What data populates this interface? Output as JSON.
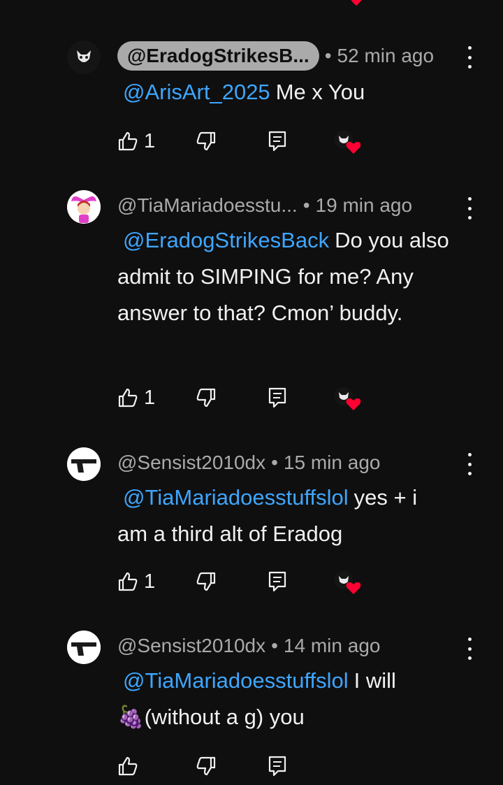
{
  "comments": [
    {
      "handle": "@EradogStrikesB...",
      "handle_style": "highlighted",
      "time": "52 min ago",
      "mention": "@ArisArt_2025",
      "text": "Me x You",
      "likes": "1",
      "creator_heart": true,
      "avatar": "white-dog-icon"
    },
    {
      "handle": "@TiaMariadoesstu...",
      "time": "19 min ago",
      "mention": "@EradogStrikesBack",
      "text": "Do you also admit to SIMPING for me? Any answer to that? Cmon’ buddy.",
      "likes": "1",
      "creator_heart": true,
      "avatar": "pink-character-icon"
    },
    {
      "handle": "@Sensist2010dx",
      "time": "15 min ago",
      "mention": "@TiaMariadoesstuffslol",
      "text": "yes + i am a third alt of Eradog",
      "likes": "1",
      "creator_heart": true,
      "avatar": "pistol-icon"
    },
    {
      "handle": "@Sensist2010dx",
      "time": "14 min ago",
      "mention": "@TiaMariadoesstuffslol",
      "text_prefix": "I will",
      "emoji": "🍇",
      "text_suffix": "(without a g) you",
      "likes": "",
      "creator_heart": false,
      "avatar": "pistol-icon"
    }
  ],
  "separator": "•",
  "colors": {
    "background": "#0f0f0f",
    "text": "#f1f1f1",
    "muted": "#aaaaaa",
    "mention": "#3ea6ff",
    "heart": "#ff0033"
  }
}
